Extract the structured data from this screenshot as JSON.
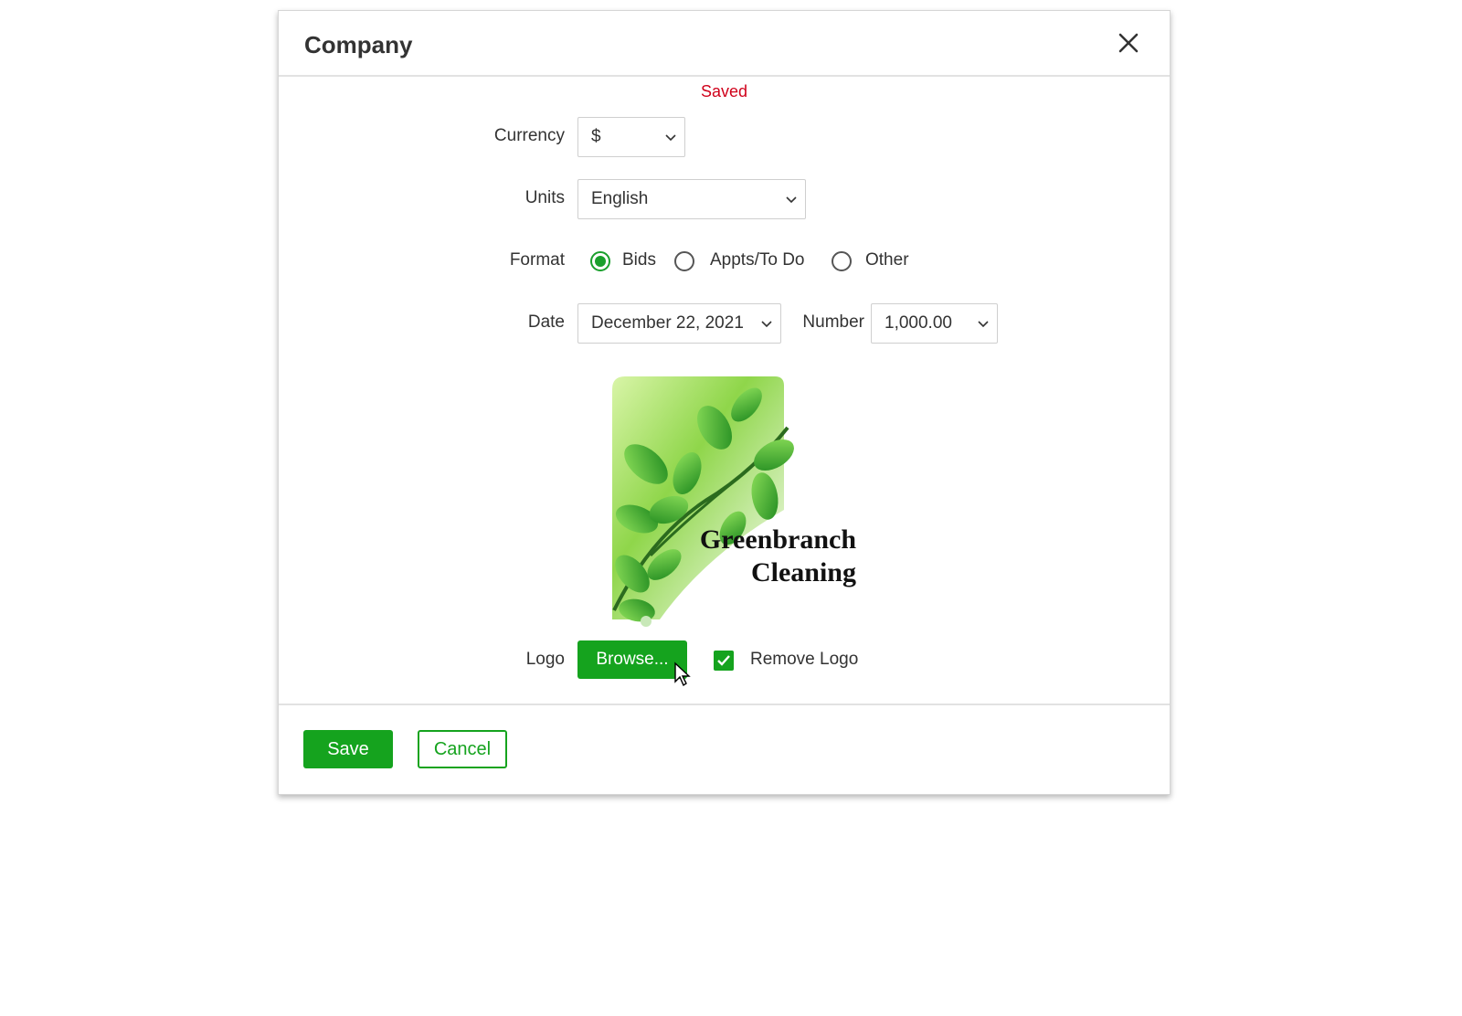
{
  "dialog": {
    "title": "Company",
    "status_message": "Saved",
    "status_color": "#d0021b",
    "close_icon": "close-icon"
  },
  "form": {
    "currency": {
      "label": "Currency",
      "value": "$"
    },
    "units": {
      "label": "Units",
      "value": "English"
    },
    "format": {
      "label": "Format",
      "options": [
        {
          "label": "Bids",
          "selected": true
        },
        {
          "label": "Appts/To Do",
          "selected": false
        },
        {
          "label": "Other",
          "selected": false
        }
      ]
    },
    "date": {
      "label": "Date",
      "value": "December 22, 2021"
    },
    "number": {
      "label": "Number",
      "value": "1,000.00"
    },
    "logo": {
      "label": "Logo",
      "image_text_line1": "Greenbranch",
      "image_text_line2": "Cleaning",
      "browse_label": "Browse...",
      "remove_label": "Remove Logo",
      "remove_checked": true
    }
  },
  "footer": {
    "save_label": "Save",
    "cancel_label": "Cancel"
  },
  "colors": {
    "accent": "#15a31e",
    "text": "#333333",
    "border": "#cfcfcf"
  }
}
